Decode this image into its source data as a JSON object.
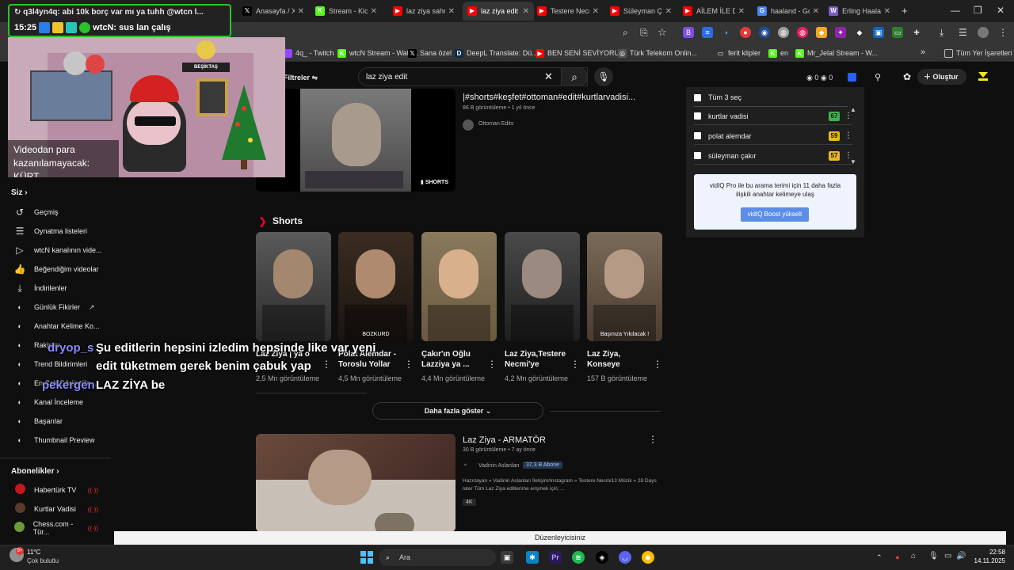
{
  "browser": {
    "tabs": [
      {
        "label": "Anasayfa / X",
        "icon": "x-icon",
        "color": "#000000",
        "glyph": "𝕏",
        "active": false
      },
      {
        "label": "Stream - Kick",
        "icon": "kick-icon",
        "color": "#53fc18",
        "glyph": "K",
        "active": false
      },
      {
        "label": "laz ziya sahn",
        "icon": "youtube-icon",
        "color": "#ff0000",
        "glyph": "▶",
        "active": false
      },
      {
        "label": "laz ziya edit",
        "icon": "youtube-icon",
        "color": "#ff0000",
        "glyph": "▶",
        "active": true
      },
      {
        "label": "Testere Necmi",
        "icon": "youtube-icon",
        "color": "#ff0000",
        "glyph": "▶",
        "active": false
      },
      {
        "label": "Süleyman Ç",
        "icon": "youtube-icon",
        "color": "#ff0000",
        "glyph": "▶",
        "active": false
      },
      {
        "label": "AİLEM İLE D",
        "icon": "youtube-icon",
        "color": "#ff0000",
        "glyph": "▶",
        "active": false
      },
      {
        "label": "haaland - Go",
        "icon": "google-icon",
        "color": "#4285f4",
        "glyph": "G",
        "active": false
      },
      {
        "label": "Erling Haalan",
        "icon": "wiki-icon",
        "color": "#7a5cc9",
        "glyph": "W",
        "active": false
      }
    ],
    "new_tab": "+",
    "bookmarks": [
      {
        "label": "4q_ - Twitch",
        "icon": "twitch-icon",
        "color": "#9146ff",
        "glyph": ""
      },
      {
        "label": "wtcN Stream - Watc...",
        "icon": "kick-icon",
        "color": "#53fc18",
        "glyph": "K"
      },
      {
        "label": "Sana özel",
        "icon": "x-icon",
        "color": "#000000",
        "glyph": "𝕏"
      },
      {
        "label": "DeepL Translate: Dü...",
        "icon": "deepl-icon",
        "color": "#0f2b46",
        "glyph": "D"
      },
      {
        "label": "BEN SENİ SEVİYORU...",
        "icon": "youtube-icon",
        "color": "#ff0000",
        "glyph": "▶"
      },
      {
        "label": "Türk Telekom Onlin...",
        "icon": "globe-icon",
        "color": "#555555",
        "glyph": "◎"
      },
      {
        "label": "ferit klipler",
        "icon": "folder-icon",
        "color": "#353535",
        "glyph": "▭"
      },
      {
        "label": "en",
        "icon": "kick-icon",
        "color": "#53fc18",
        "glyph": "K"
      },
      {
        "label": "Mr_Jelal Stream - W...",
        "icon": "kick-icon",
        "color": "#53fc18",
        "glyph": "K"
      }
    ],
    "all_bookmarks": "Tüm Yer İşaretleri"
  },
  "youtube": {
    "filters_label": "Filtreler",
    "search_value": "laz ziya edit",
    "counter_a": "0",
    "counter_b": "0",
    "create_label": "Oluştur",
    "top_video": {
      "title": "|#shorts#keşfet#ottoman#edit#kurtlarvadisi...",
      "meta": "86 B görüntüleme • 1 yıl önce",
      "channel": "Ottoman Edits",
      "badge": "SHORTS"
    },
    "shorts_heading": "Shorts",
    "shorts": [
      {
        "title": "Laz Ziya | ya o ...",
        "views": "2,5 Mn görüntüleme",
        "overlay": ""
      },
      {
        "title": "Polat Alemdar - Toroslu Yollar",
        "views": "4,5 Mn görüntüleme",
        "overlay": "BOZKURD"
      },
      {
        "title": "Çakır'ın Oğlu Lazziya ya ...",
        "views": "4,4 Mn görüntüleme",
        "overlay": ""
      },
      {
        "title": "Laz Ziya,Testere Necmi'ye racon...",
        "views": "4,2 Mn görüntüleme",
        "overlay": ""
      },
      {
        "title": "Laz Ziya, Konseye Racon...",
        "views": "157 B görüntüleme",
        "overlay": "Başınıza Yıkılacak !"
      }
    ],
    "show_more": "Daha fazla göster",
    "video2": {
      "title": "Laz Ziya - ARMATÖR",
      "meta": "30 B görüntüleme • 7 ay önce",
      "channel": "Vadinin Aslanları",
      "subs": "37,3 B Abone",
      "desc": "Hazırlayan » Vadinin Aslanları İletişim/Instagram » Testere.Necmi13 Müzik » 28 Days later Tüm Laz Ziya editlerime erişmek için; ...",
      "badge": "4K"
    }
  },
  "sidebar": {
    "you_label": "Siz",
    "items": [
      {
        "label": "Geçmiş",
        "icon": "history-icon",
        "glyph": "↺"
      },
      {
        "label": "Oynatma listeleri",
        "icon": "playlist-icon",
        "glyph": "☰"
      },
      {
        "label": "wtcN kanalının vide...",
        "icon": "video-icon",
        "glyph": "▷"
      },
      {
        "label": "Beğendiğim videolar",
        "icon": "like-icon",
        "glyph": "👍"
      },
      {
        "label": "İndirilenler",
        "icon": "download-icon",
        "glyph": "⤓"
      },
      {
        "label": "Günlük Fikirler",
        "icon": "vidiq-icon",
        "glyph": "◐"
      },
      {
        "label": "Anahtar Kelime Ko...",
        "icon": "vidiq-icon",
        "glyph": "◐"
      },
      {
        "label": "Rakipler",
        "icon": "vidiq-icon",
        "glyph": "◐"
      },
      {
        "label": "Trend Bildirimleri",
        "icon": "vidiq-icon",
        "glyph": "◐"
      },
      {
        "label": "En Çok Görüntüle...",
        "icon": "vidiq-icon",
        "glyph": "◐"
      },
      {
        "label": "Kanal İnceleme",
        "icon": "vidiq-icon",
        "glyph": "◐"
      },
      {
        "label": "Başarılar",
        "icon": "vidiq-icon",
        "glyph": "◐"
      },
      {
        "label": "Thumbnail Preview",
        "icon": "vidiq-icon",
        "glyph": "◐"
      }
    ],
    "subs_label": "Abonelikler",
    "subs": [
      {
        "label": "Habertürk TV",
        "color": "#c4161c"
      },
      {
        "label": "Kurtlar Vadisi",
        "color": "#5a3a2a"
      },
      {
        "label": "Chess.com - Tür...",
        "color": "#6b9a3a"
      }
    ]
  },
  "vidiq": {
    "select_all": "Tüm 3 seç",
    "keywords": [
      {
        "label": "kurtlar vadisi",
        "score": "67",
        "color": "#3cb44b"
      },
      {
        "label": "polat alemdar",
        "score": "59",
        "color": "#e9b824"
      },
      {
        "label": "süleyman çakır",
        "score": "57",
        "color": "#e9b824"
      }
    ],
    "pro_text": "vidIQ Pro ile bu arama terimi için 11 daha fazla ilişkili anahtar kelimeye ulaş",
    "boost_label": "vidIQ Boost yükselt"
  },
  "stream": {
    "top_chat": "q3l4yn4q: abi 10k borç var mı ya tuhh @wtcn l...",
    "time": "15:25",
    "chat2": "wtcN: sus lan çalış",
    "cam_caption": "Videodan para kazanılamayacak: KÜRT",
    "sign": "BEŞİKTAŞ",
    "messages": [
      {
        "user": "dryop_s",
        "text": "Şu editlerin hepsini izledim hepsinde like var yeni"
      },
      {
        "user": "",
        "text": "edit tüketmem gerek benim çabuk yap"
      },
      {
        "user": "pekergen",
        "text": "LAZ ZİYA be"
      }
    ]
  },
  "editor_label": "Düzenleyicisiniz",
  "taskbar": {
    "weather_temp": "11°C",
    "weather_desc": "Çok bulutlu",
    "search": "Ara",
    "time": "22:58",
    "date": "14.11.2025"
  }
}
